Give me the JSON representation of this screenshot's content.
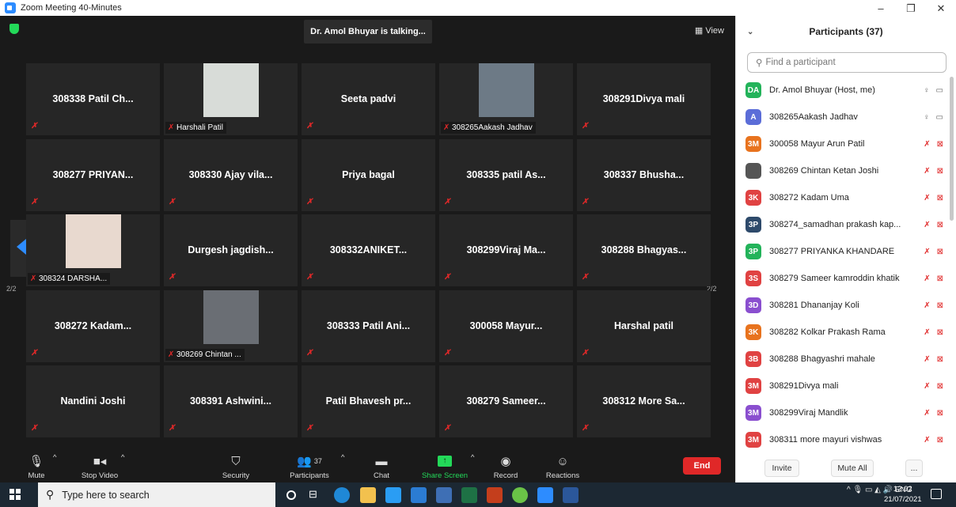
{
  "window": {
    "title": "Zoom Meeting 40-Minutes",
    "controls": [
      "–",
      "❐",
      "✕"
    ]
  },
  "meeting": {
    "talking_indicator": "Dr. Amol Bhuyar is talking...",
    "view_label": "View",
    "page_left": "2/2",
    "page_right": "2/2",
    "tiles": [
      {
        "name": "308338 Patil Ch...",
        "kind": "name"
      },
      {
        "name": "Harshali Patil",
        "kind": "photo",
        "photo_color": "#d8dcd8"
      },
      {
        "name": "Seeta padvi",
        "kind": "name"
      },
      {
        "name": "308265Aakash Jadhav",
        "kind": "photo",
        "photo_color": "#6d7a86"
      },
      {
        "name": "308291Divya mali",
        "kind": "name"
      },
      {
        "name": "308277 PRIYAN...",
        "kind": "name"
      },
      {
        "name": "308330 Ajay vila...",
        "kind": "name"
      },
      {
        "name": "Priya bagal",
        "kind": "name"
      },
      {
        "name": "308335 patil As...",
        "kind": "name"
      },
      {
        "name": "308337 Bhusha...",
        "kind": "name"
      },
      {
        "name": "308324 DARSHA...",
        "kind": "photo",
        "photo_color": "#e8d9cf"
      },
      {
        "name": "Durgesh jagdish...",
        "kind": "name"
      },
      {
        "name": "308332ANIKET...",
        "kind": "name"
      },
      {
        "name": "308299Viraj Ma...",
        "kind": "name"
      },
      {
        "name": "308288 Bhagyas...",
        "kind": "name"
      },
      {
        "name": "308272 Kadam...",
        "kind": "name"
      },
      {
        "name": "308269 Chintan ...",
        "kind": "photo",
        "photo_color": "#6a6e74"
      },
      {
        "name": "308333 Patil Ani...",
        "kind": "name"
      },
      {
        "name": "300058 Mayur...",
        "kind": "name"
      },
      {
        "name": "Harshal patil",
        "kind": "name"
      },
      {
        "name": "Nandini Joshi",
        "kind": "name"
      },
      {
        "name": "308391 Ashwini...",
        "kind": "name"
      },
      {
        "name": "Patil Bhavesh pr...",
        "kind": "name"
      },
      {
        "name": "308279 Sameer...",
        "kind": "name"
      },
      {
        "name": "308312 More Sa...",
        "kind": "name"
      }
    ]
  },
  "toolbar": {
    "mute": "Mute",
    "stop_video": "Stop Video",
    "security": "Security",
    "participants": "Participants",
    "participants_count": "37",
    "chat": "Chat",
    "share_screen": "Share Screen",
    "record": "Record",
    "reactions": "Reactions",
    "end": "End"
  },
  "panel": {
    "title": "Participants (37)",
    "search_placeholder": "Find a participant",
    "invite": "Invite",
    "mute_all": "Mute All",
    "more": "...",
    "participants": [
      {
        "initials": "DA",
        "color": "#23b35a",
        "name": "Dr. Amol Bhuyar (Host, me)",
        "muted": false
      },
      {
        "initials": "A",
        "color": "#5b6dd8",
        "name": "308265Aakash Jadhav",
        "muted": false
      },
      {
        "initials": "3M",
        "color": "#e8731e",
        "name": "300058 Mayur Arun Patil",
        "muted": true
      },
      {
        "initials": "",
        "color": "#555555",
        "name": "308269 Chintan Ketan Joshi",
        "muted": true
      },
      {
        "initials": "3K",
        "color": "#e04242",
        "name": "308272 Kadam Uma",
        "muted": true
      },
      {
        "initials": "3P",
        "color": "#2e4a6b",
        "name": "308274_samadhan prakash kap...",
        "muted": true
      },
      {
        "initials": "3P",
        "color": "#23b35a",
        "name": "308277 PRIYANKA  KHANDARE",
        "muted": true
      },
      {
        "initials": "3S",
        "color": "#e04242",
        "name": "308279 Sameer kamroddin khatik",
        "muted": true
      },
      {
        "initials": "3D",
        "color": "#8a4fcf",
        "name": "308281 Dhananjay Koli",
        "muted": true
      },
      {
        "initials": "3K",
        "color": "#e8731e",
        "name": "308282 Kolkar Prakash Rama",
        "muted": true
      },
      {
        "initials": "3B",
        "color": "#e04242",
        "name": "308288 Bhagyashri mahale",
        "muted": true
      },
      {
        "initials": "3M",
        "color": "#e04242",
        "name": "308291Divya mali",
        "muted": true
      },
      {
        "initials": "3M",
        "color": "#8a4fcf",
        "name": "308299Viraj Mandlik",
        "muted": true
      },
      {
        "initials": "3M",
        "color": "#e04242",
        "name": "308311 more mayuri vishwas",
        "muted": true
      }
    ]
  },
  "taskbar": {
    "search_placeholder": "Type here to search",
    "tray_lang": "ENG",
    "time": "12:02",
    "date": "21/07/2021"
  },
  "colors": {
    "accent": "#2d8cff",
    "danger": "#e02828",
    "share_green": "#23d959"
  }
}
